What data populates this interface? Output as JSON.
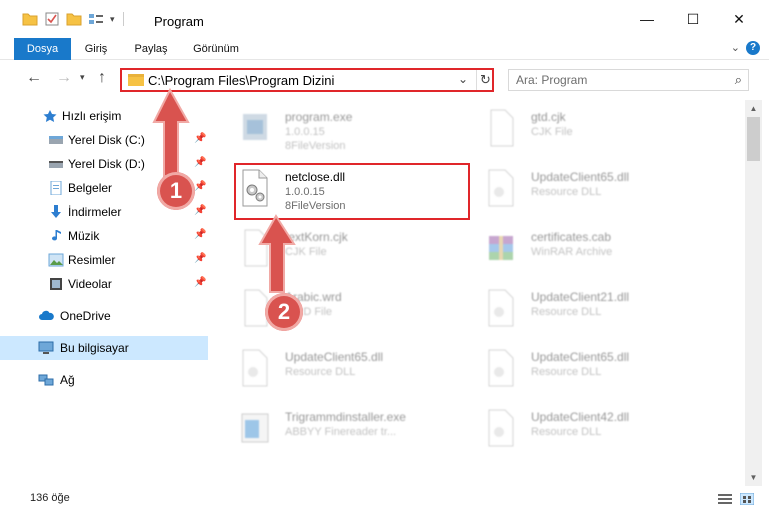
{
  "window": {
    "title": "Program",
    "controls": {
      "minimize": "—",
      "maximize": "☐",
      "close": "✕"
    }
  },
  "ribbon": {
    "tabs": [
      "Dosya",
      "Giriş",
      "Paylaş",
      "Görünüm"
    ],
    "help": "?"
  },
  "address": {
    "path": "C:\\Program Files\\Program Dizini",
    "search_placeholder": "Ara: Program"
  },
  "sidebar": {
    "quick_access": "Hızlı erişim",
    "items": [
      {
        "label": "Yerel Disk (C:)",
        "icon": "drive-icon",
        "pinned": true
      },
      {
        "label": "Yerel Disk (D:)",
        "icon": "drive-icon",
        "pinned": true
      },
      {
        "label": "Belgeler",
        "icon": "documents-icon",
        "pinned": true
      },
      {
        "label": "İndirmeler",
        "icon": "downloads-icon",
        "pinned": true
      },
      {
        "label": "Müzik",
        "icon": "music-icon",
        "pinned": true
      },
      {
        "label": "Resimler",
        "icon": "pictures-icon",
        "pinned": true
      },
      {
        "label": "Videolar",
        "icon": "videos-icon",
        "pinned": true
      }
    ],
    "onedrive": "OneDrive",
    "this_pc": "Bu bilgisayar",
    "network": "Ağ"
  },
  "files": [
    {
      "name": "program.exe",
      "line1": "1.0.0.15",
      "line2": "8FileVersion",
      "icon": "exe-icon"
    },
    {
      "name": "gtd.cjk",
      "line1": "CJK File",
      "line2": "",
      "icon": "generic-file-icon"
    },
    {
      "name": "netclose.dll",
      "line1": "1.0.0.15",
      "line2": "8FileVersion",
      "icon": "dll-icon"
    },
    {
      "name": "UpdateClient65.dll",
      "line1": "Resource DLL",
      "line2": "",
      "icon": "dll-icon"
    },
    {
      "name": "textKorn.cjk",
      "line1": "CJK File",
      "line2": "",
      "icon": "generic-file-icon"
    },
    {
      "name": "certificates.cab",
      "line1": "WinRAR Archive",
      "line2": "",
      "icon": "winrar-icon"
    },
    {
      "name": "Arabic.wrd",
      "line1": "WRD File",
      "line2": "",
      "icon": "generic-file-icon"
    },
    {
      "name": "UpdateClient21.dll",
      "line1": "Resource DLL",
      "line2": "",
      "icon": "dll-icon"
    },
    {
      "name": "UpdateClient65.dll",
      "line1": "Resource DLL",
      "line2": "",
      "icon": "dll-icon"
    },
    {
      "name": "UpdateClient65.dll",
      "line1": "Resource DLL",
      "line2": "",
      "icon": "dll-icon"
    },
    {
      "name": "Trigrammdinstaller.exe",
      "line1": "ABBYY Finereader tr...",
      "line2": "",
      "icon": "installer-icon"
    },
    {
      "name": "UpdateClient42.dll",
      "line1": "Resource DLL",
      "line2": "",
      "icon": "dll-icon"
    }
  ],
  "status": {
    "item_count": "136 öğe"
  },
  "annotations": {
    "step1": "1",
    "step2": "2"
  },
  "colors": {
    "accent": "#1979ca",
    "highlight_red": "#e0262a",
    "bubble_red": "#d9534f",
    "selected_bg": "#cce8ff",
    "folder_yellow": "#f6c244"
  }
}
